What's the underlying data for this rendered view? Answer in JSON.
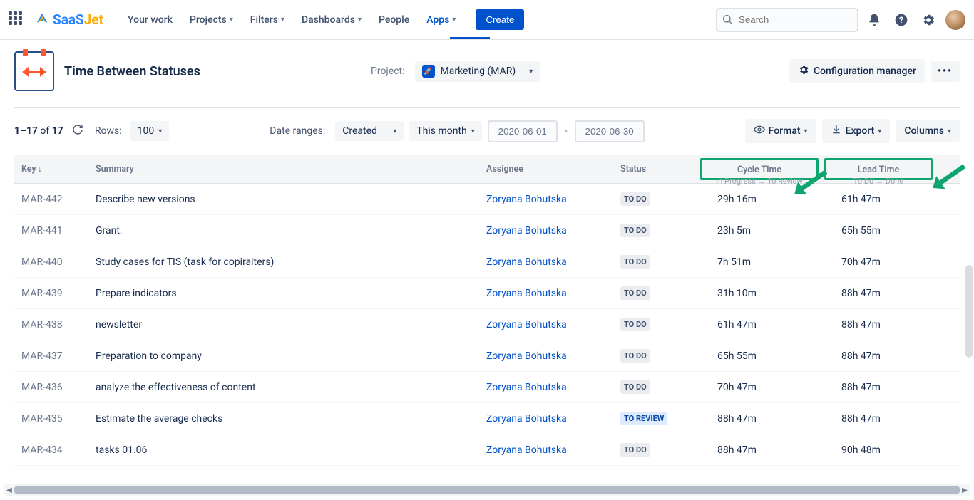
{
  "nav": {
    "your_work": "Your work",
    "projects": "Projects",
    "filters": "Filters",
    "dashboards": "Dashboards",
    "people": "People",
    "apps": "Apps",
    "create": "Create",
    "search_placeholder": "Search"
  },
  "logo": {
    "saas": "SaaS",
    "jet": "Jet"
  },
  "app": {
    "title": "Time Between Statuses",
    "project_label": "Project:",
    "project_name": "Marketing (MAR)",
    "config_manager": "Configuration manager",
    "more": "•••"
  },
  "toolbar": {
    "count_range": "1–17",
    "count_of": "of",
    "count_total": "17",
    "rows_label": "Rows:",
    "rows_value": "100",
    "date_ranges_label": "Date ranges:",
    "created": "Created",
    "this_month": "This month",
    "date_from": "2020-06-01",
    "date_to": "2020-06-30",
    "format": "Format",
    "export": "Export",
    "columns": "Columns"
  },
  "table": {
    "headers": {
      "key": "Key",
      "summary": "Summary",
      "assignee": "Assignee",
      "status": "Status",
      "cycle_time": "Cycle Time",
      "cycle_sub": "In Progress → To Review",
      "lead_time": "Lead Time",
      "lead_sub": "To Do → Done"
    },
    "rows": [
      {
        "key": "MAR-442",
        "summary": "Describe new versions",
        "assignee": "Zoryana Bohutska",
        "status": "TO DO",
        "status_class": "todo",
        "cycle": "29h 16m",
        "lead": "61h 47m"
      },
      {
        "key": "MAR-441",
        "summary": "Grant:",
        "assignee": "Zoryana Bohutska",
        "status": "TO DO",
        "status_class": "todo",
        "cycle": "23h 5m",
        "lead": "65h 55m"
      },
      {
        "key": "MAR-440",
        "summary": "Study cases for TIS (task for copiraiters)",
        "assignee": "Zoryana Bohutska",
        "status": "TO DO",
        "status_class": "todo",
        "cycle": "7h 51m",
        "lead": "70h 47m"
      },
      {
        "key": "MAR-439",
        "summary": "Prepare indicators",
        "assignee": "Zoryana Bohutska",
        "status": "TO DO",
        "status_class": "todo",
        "cycle": "31h 10m",
        "lead": "88h 47m"
      },
      {
        "key": "MAR-438",
        "summary": "newsletter",
        "assignee": "Zoryana Bohutska",
        "status": "TO DO",
        "status_class": "todo",
        "cycle": "61h 47m",
        "lead": "88h 47m"
      },
      {
        "key": "MAR-437",
        "summary": "Preparation to company",
        "assignee": "Zoryana Bohutska",
        "status": "TO DO",
        "status_class": "todo",
        "cycle": "65h 55m",
        "lead": "88h 47m"
      },
      {
        "key": "MAR-436",
        "summary": "analyze the effectiveness of content",
        "assignee": "Zoryana Bohutska",
        "status": "TO DO",
        "status_class": "todo",
        "cycle": "70h 47m",
        "lead": "88h 47m"
      },
      {
        "key": "MAR-435",
        "summary": "Estimate the average checks",
        "assignee": "Zoryana Bohutska",
        "status": "TO REVIEW",
        "status_class": "review",
        "cycle": "88h 47m",
        "lead": "88h 47m"
      },
      {
        "key": "MAR-434",
        "summary": "tasks 01.06",
        "assignee": "Zoryana Bohutska",
        "status": "TO DO",
        "status_class": "todo",
        "cycle": "88h 47m",
        "lead": "90h 48m"
      }
    ]
  }
}
